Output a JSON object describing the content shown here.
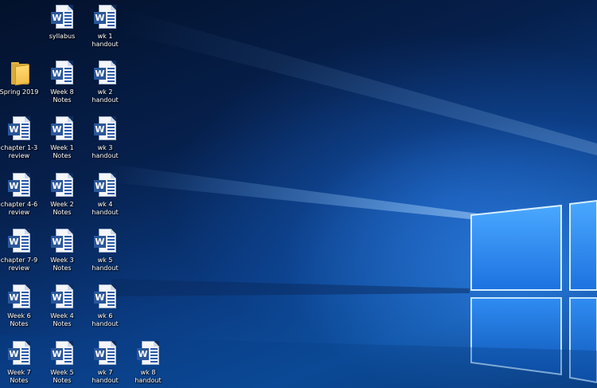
{
  "desktop": {
    "icons": [
      {
        "label": "syllabus",
        "type": "word"
      },
      {
        "label": "wk 1\nhandout",
        "type": "word"
      },
      {
        "label": "Spring 2019",
        "type": "folder"
      },
      {
        "label": "Week 8\nNotes",
        "type": "word"
      },
      {
        "label": "wk 2\nhandout",
        "type": "word"
      },
      {
        "label": "chapter 1-3\nreview",
        "type": "word"
      },
      {
        "label": "Week 1\nNotes",
        "type": "word"
      },
      {
        "label": "wk 3\nhandout",
        "type": "word"
      },
      {
        "label": "chapter 4-6\nreview",
        "type": "word"
      },
      {
        "label": "Week 2\nNotes",
        "type": "word"
      },
      {
        "label": "wk 4\nhandout",
        "type": "word"
      },
      {
        "label": "chapter 7-9\nreview",
        "type": "word"
      },
      {
        "label": "Week 3\nNotes",
        "type": "word"
      },
      {
        "label": "wk 5\nhandout",
        "type": "word"
      },
      {
        "label": "Week 6\nNotes",
        "type": "word"
      },
      {
        "label": "Week 4\nNotes",
        "type": "word"
      },
      {
        "label": "wk 6\nhandout",
        "type": "word"
      },
      {
        "label": "Week 7\nNotes",
        "type": "word"
      },
      {
        "label": "Week 5\nNotes",
        "type": "word"
      },
      {
        "label": "wk 7\nhandout",
        "type": "word"
      },
      {
        "label": "wk 8\nhandout",
        "type": "word"
      }
    ],
    "word_badge": "W",
    "colors": {
      "word_blue": "#2b579a",
      "folder_yellow": "#f2bf4a",
      "wallpaper_glow": "#3c96ff"
    }
  }
}
